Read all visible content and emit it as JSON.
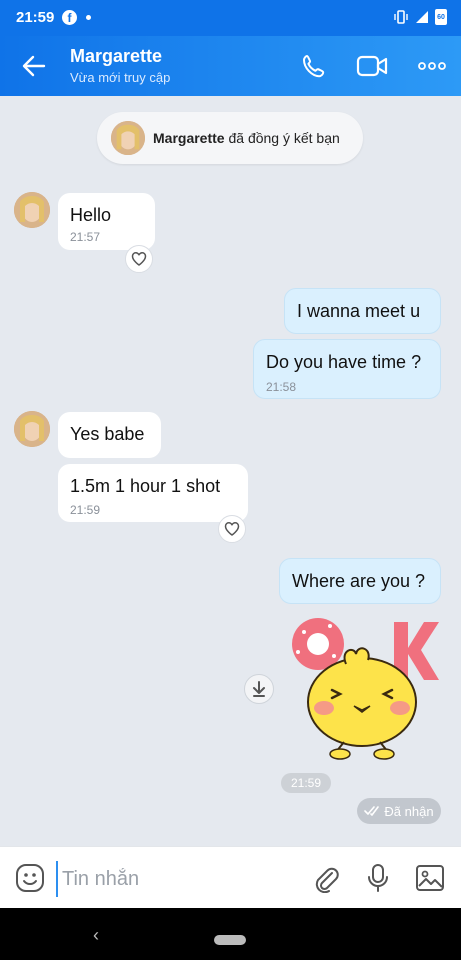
{
  "status_bar": {
    "time": "21:59",
    "battery": "60"
  },
  "header": {
    "contact_name": "Margarette",
    "contact_status": "Vừa mới truy cập"
  },
  "system_message": {
    "name": "Margarette",
    "text": " đã đồng ý kết bạn"
  },
  "messages": [
    {
      "sender": "them",
      "text": "Hello",
      "time": "21:57"
    },
    {
      "sender": "me",
      "text": "I wanna meet u"
    },
    {
      "sender": "me",
      "text": "Do you have time ?",
      "time": "21:58"
    },
    {
      "sender": "them",
      "text": "Yes babe"
    },
    {
      "sender": "them",
      "text": "1.5m 1 hour 1 shot",
      "time": "21:59"
    },
    {
      "sender": "me",
      "text": "Where are you ?"
    }
  ],
  "sticker": {
    "text": "OK"
  },
  "sticker_time": "21:59",
  "delivery_status": "Đã nhận",
  "input": {
    "placeholder": "Tin nhắn"
  },
  "colors": {
    "brand": "#0f73e8",
    "outgoing_bubble": "#daf0fe",
    "background": "#e5e9ef"
  }
}
